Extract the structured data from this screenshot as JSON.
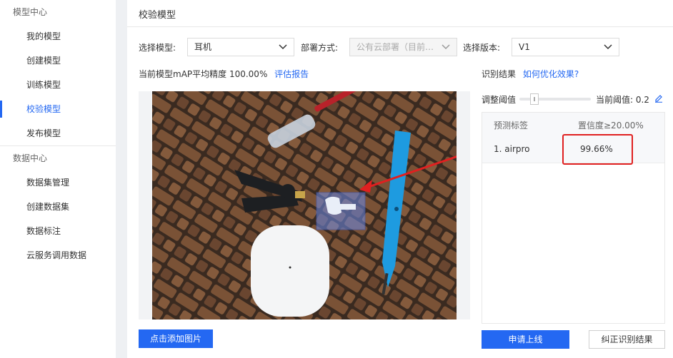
{
  "sidebar": {
    "model_center": "模型中心",
    "model_items": [
      {
        "label": "我的模型"
      },
      {
        "label": "创建模型"
      },
      {
        "label": "训练模型"
      },
      {
        "label": "校验模型"
      },
      {
        "label": "发布模型"
      }
    ],
    "data_center": "数据中心",
    "data_items": [
      {
        "label": "数据集管理"
      },
      {
        "label": "创建数据集"
      },
      {
        "label": "数据标注"
      },
      {
        "label": "云服务调用数据"
      }
    ]
  },
  "header": {
    "title": "校验模型"
  },
  "filters": {
    "model_label": "选择模型:",
    "model_value": "耳机",
    "deploy_label": "部署方式:",
    "deploy_value": "公有云部署（目前仅...",
    "version_label": "选择版本:",
    "version_value": "V1"
  },
  "metric": {
    "text": "当前模型mAP平均精度 100.00%",
    "report_link": "评估报告"
  },
  "results": {
    "title": "识别结果",
    "optimize_link": "如何优化效果?",
    "threshold_label": "调整阈值",
    "current_threshold_label": "当前阈值: 0.2",
    "threshold_value": 0.2,
    "col_label": "预测标签",
    "col_conf": "置信度≥20.00%",
    "rows": [
      {
        "label": "1. airpro",
        "confidence": "99.66%"
      }
    ]
  },
  "buttons": {
    "add_image": "点击添加图片",
    "apply_online": "申请上线",
    "correct_result": "纠正识别结果"
  },
  "colors": {
    "accent": "#2468f2",
    "highlight": "#e02020"
  },
  "icons": {
    "edit": "edit-icon",
    "chevron": "chevron-down-icon"
  }
}
